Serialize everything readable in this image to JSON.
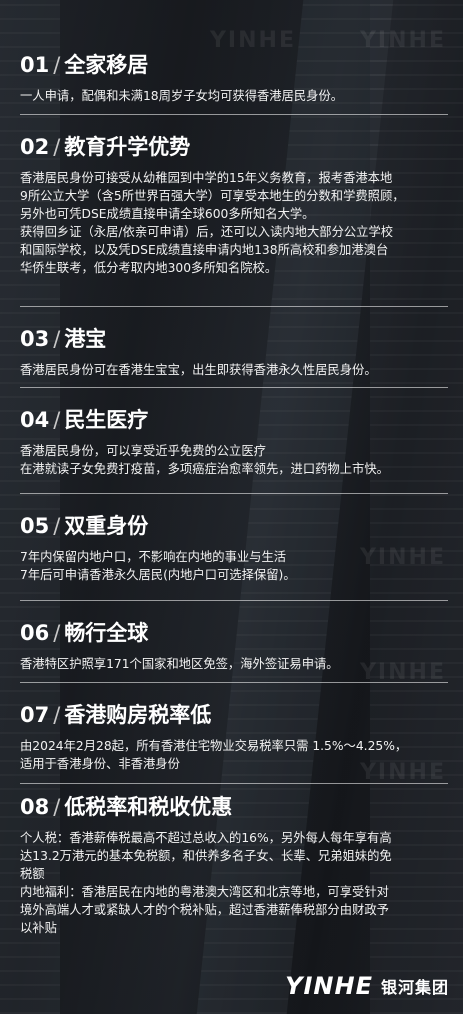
{
  "watermark": "YINHE",
  "sections": [
    {
      "num": "01",
      "title": "全家移居",
      "lines": [
        "一人申请，配偶和未满18周岁子女均可获得香港居民身份。"
      ]
    },
    {
      "num": "02",
      "title": "教育升学优势",
      "lines": [
        "香港居民身份可接受从幼稚园到中学的15年义务教育，报考香港本地",
        "9所公立大学（含5所世界百强大学）可享受本地生的分数和学费照顾，",
        "另外也可凭DSE成绩直接申请全球600多所知名大学。",
        "获得回乡证（永居/依亲可申请）后，还可以入读内地大部分公立学校",
        "和国际学校，以及凭DSE成绩直接申请内地138所高校和参加港澳台",
        "华侨生联考，低分考取内地300多所知名院校。"
      ]
    },
    {
      "num": "03",
      "title": "港宝",
      "lines": [
        "香港居民身份可在香港生宝宝，出生即获得香港永久性居民身份。"
      ]
    },
    {
      "num": "04",
      "title": "民生医疗",
      "lines": [
        "香港居民身份，可以享受近乎免费的公立医疗",
        "在港就读子女免费打疫苗，多项癌症治愈率领先，进口药物上市快。"
      ]
    },
    {
      "num": "05",
      "title": "双重身份",
      "lines": [
        "7年内保留内地户口，不影响在内地的事业与生活",
        "7年后可申请香港永久居民(内地户口可选择保留)。"
      ]
    },
    {
      "num": "06",
      "title": "畅行全球",
      "lines": [
        "香港特区护照享171个国家和地区免签，海外签证易申请。"
      ]
    },
    {
      "num": "07",
      "title": "香港购房税率低",
      "lines": [
        "由2024年2月28起，所有香港住宅物业交易税率只需 1.5%～4.25%，",
        "适用于香港身份、非香港身份"
      ]
    },
    {
      "num": "08",
      "title": "低税率和税收优惠",
      "lines": [
        "个人税：香港薪俸税最高不超过总收入的16%，另外每人每年享有高",
        "达13.2万港元的基本免税额，和供养多名子女、长辈、兄弟姐妹的免",
        "税额",
        "内地福利：香港居民在内地的粤港澳大湾区和北京等地，可享受针对",
        "境外高端人才或紧缺人才的个税补贴，超过香港薪俸税部分由财政予",
        "以补贴"
      ]
    }
  ],
  "logo": {
    "mark": "YINHE",
    "name": "银河集团"
  }
}
